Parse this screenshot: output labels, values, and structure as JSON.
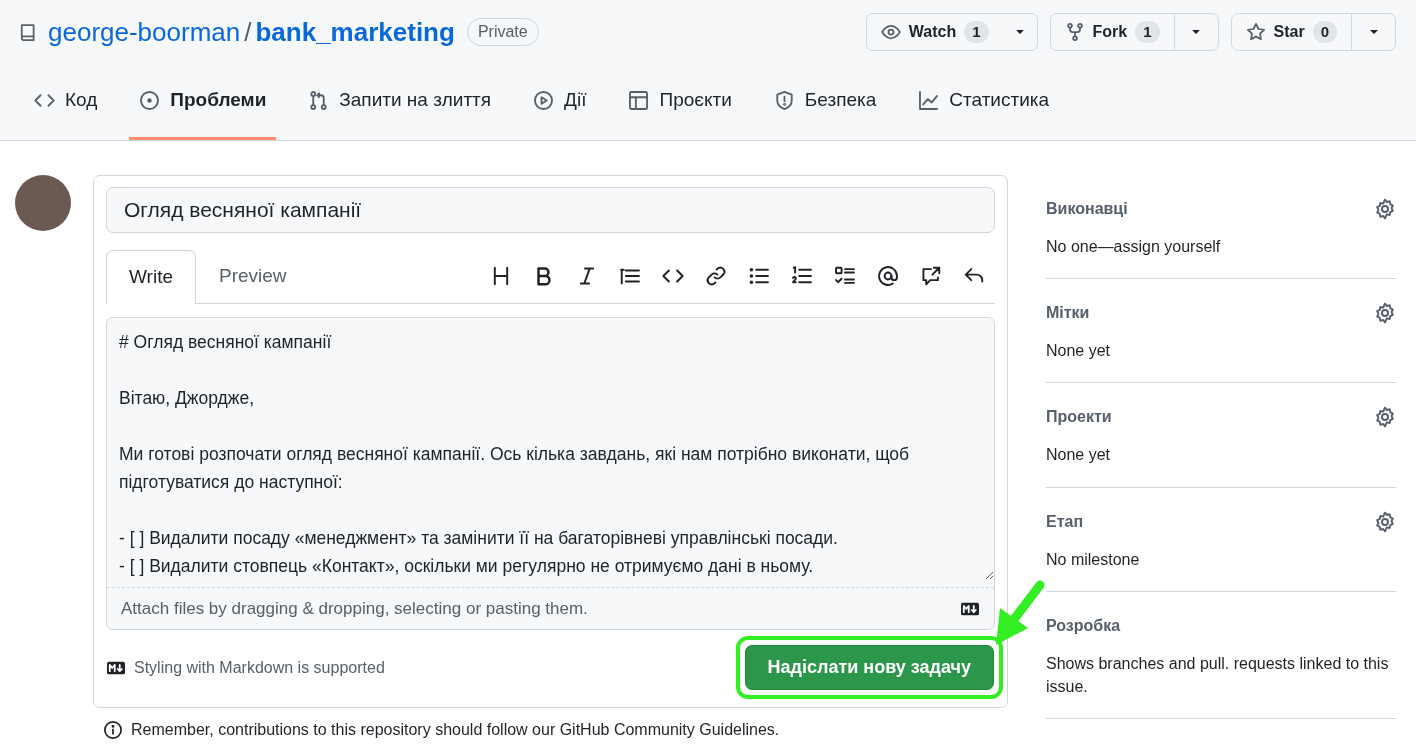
{
  "repo": {
    "owner": "george-boorman",
    "separator": "/",
    "name": "bank_marketing",
    "visibility": "Private"
  },
  "actions": [
    {
      "kind": "watch",
      "label": "Watch",
      "count": "1"
    },
    {
      "kind": "fork",
      "label": "Fork",
      "count": "1"
    },
    {
      "kind": "star",
      "label": "Star",
      "count": "0"
    }
  ],
  "tabs": [
    {
      "kind": "code",
      "label": "Код",
      "selected": false
    },
    {
      "kind": "issues",
      "label": "Проблеми",
      "selected": true
    },
    {
      "kind": "pulls",
      "label": "Запити на злиття",
      "selected": false
    },
    {
      "kind": "actions",
      "label": "Дії",
      "selected": false
    },
    {
      "kind": "projects",
      "label": "Проєкти",
      "selected": false
    },
    {
      "kind": "security",
      "label": "Безпека",
      "selected": false
    },
    {
      "kind": "insights",
      "label": "Статистика",
      "selected": false
    }
  ],
  "issue": {
    "title": "Огляд весняної кампанії",
    "editor_tabs": [
      {
        "label": "Write",
        "selected": true
      },
      {
        "label": "Preview",
        "selected": false
      }
    ],
    "body": [
      [
        "# Огляд весняної кампанії"
      ],
      [
        "Вітаю, Джордже,"
      ],
      [
        "Ми готові розпочати огляд весняної кампанії. Ось кілька завдань, які нам потрібно виконати, щоб підготуватися до наступної:"
      ],
      [
        "- [ ] Видалити посаду «менеджмент» та замінити її на багаторівневі управлінські посади.",
        "- [ ] Видалити стовпець «Контакт», оскільки ми регулярно не отримуємо дані в ньому."
      ]
    ],
    "attach_hint": "Attach files by dragging & dropping, selecting or pasting them.",
    "markdown_note": "Styling with Markdown is supported",
    "submit_label": "Надіслати нову задачу"
  },
  "notice": {
    "text": "Remember, contributions to this repository should follow our",
    "link": "GitHub Community Guidelines",
    "end": "."
  },
  "sidebar": [
    {
      "heading": "Виконавці",
      "value": "No one—assign yourself"
    },
    {
      "heading": "Мітки",
      "value": "None yet"
    },
    {
      "heading": "Проекти",
      "value": "None yet"
    },
    {
      "heading": "Етап",
      "value": "No milestone"
    },
    {
      "heading": "Розробка",
      "value": "Shows branches and pull. requests linked to this issue."
    }
  ]
}
